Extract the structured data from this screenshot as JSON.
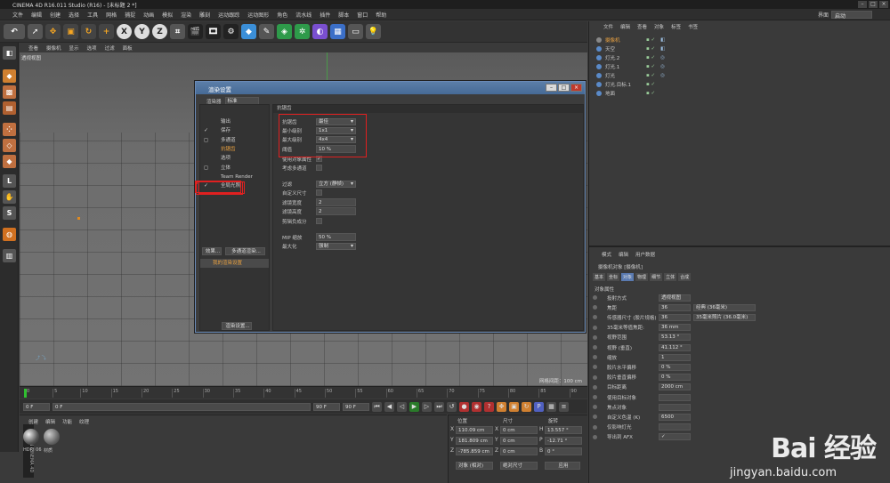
{
  "app": {
    "title": "CINEMA 4D R16.011 Studio (R16) - [未标题 2 *]"
  },
  "menubar": [
    "文件",
    "编辑",
    "创建",
    "选择",
    "工具",
    "网格",
    "捕捉",
    "动画",
    "模拟",
    "渲染",
    "雕刻",
    "运动跟踪",
    "运动图形",
    "角色",
    "流水线",
    "插件",
    "脚本",
    "窗口",
    "帮助"
  ],
  "layout": {
    "label": "界面",
    "value": "启动"
  },
  "toolbar_icons": [
    "undo-icon",
    "select-icon",
    "move-icon",
    "scale-icon",
    "rotate-icon",
    "add-icon",
    "x-axis-icon",
    "y-axis-icon",
    "z-axis-icon",
    "coord-icon",
    "render-view-icon",
    "render-picture-icon",
    "render-settings-icon",
    "cube-icon",
    "pen-icon",
    "subdivision-icon",
    "array-icon",
    "deformer-icon",
    "floor-icon",
    "camera-icon",
    "light-icon"
  ],
  "toolbar_axis": {
    "x": "X",
    "y": "Y",
    "z": "Z"
  },
  "viewport": {
    "menu": [
      "查看",
      "摄像机",
      "显示",
      "选项",
      "过滤",
      "面板"
    ],
    "label": "透视视图",
    "grid_spacing": "网格间距：100 cm"
  },
  "timeline": {
    "ticks": [
      "0",
      "5",
      "10",
      "15",
      "20",
      "25",
      "30",
      "35",
      "40",
      "45",
      "50",
      "55",
      "60",
      "65",
      "70",
      "75",
      "80",
      "85",
      "90"
    ],
    "frame_start": "0 F",
    "frame_current": "0 F",
    "frame_end": "90 F",
    "frame_end2": "90 F"
  },
  "material": {
    "menu": [
      "创建",
      "编辑",
      "功能",
      "纹理"
    ],
    "items": [
      "HDRI 06",
      "材质"
    ]
  },
  "coords": {
    "headers": [
      "位置",
      "尺寸",
      "旋转"
    ],
    "rows": [
      {
        "axis": "X",
        "pos": "110.09 cm",
        "size": "0 cm",
        "rot_axis": "H",
        "rot": "13.557 °"
      },
      {
        "axis": "Y",
        "pos": "181.809 cm",
        "size": "0 cm",
        "rot_axis": "P",
        "rot": "-12.71 °"
      },
      {
        "axis": "Z",
        "pos": "-785.859 cm",
        "size": "0 cm",
        "rot_axis": "B",
        "rot": "0 °"
      }
    ],
    "mode1": "对象 (相对)",
    "mode2": "绝对尺寸",
    "apply": "应用"
  },
  "objects": {
    "menu": [
      "文件",
      "编辑",
      "查看",
      "对象",
      "标签",
      "书签"
    ],
    "items": [
      {
        "name": "摄像机",
        "color": "#e8a040"
      },
      {
        "name": "天空",
        "color": "#c8c8c8"
      },
      {
        "name": "灯光.2",
        "color": "#c8c8c8"
      },
      {
        "name": "灯光.1",
        "color": "#c8c8c8"
      },
      {
        "name": "灯光",
        "color": "#c8c8c8"
      },
      {
        "name": "灯光.目标.1",
        "color": "#c8c8c8"
      },
      {
        "name": "地面",
        "color": "#c8c8c8"
      }
    ]
  },
  "attributes": {
    "menu": [
      "模式",
      "编辑",
      "用户数据"
    ],
    "object_title": "摄像机对象 [摄像机]",
    "tabs": [
      "基本",
      "坐标",
      "对象",
      "物理",
      "细节",
      "立体",
      "合成"
    ],
    "active_tab": "对象",
    "section": "对象属性",
    "rows": [
      {
        "label": "投射方式",
        "value": "透视视图"
      },
      {
        "label": "焦距",
        "value": "36",
        "extra": "经典 (36毫米)"
      },
      {
        "label": "传感器尺寸 (胶片规格)",
        "value": "36",
        "extra": "35毫米照片 (36.0毫米)"
      },
      {
        "label": "35毫米等值焦距:",
        "value": "36 mm"
      },
      {
        "label": "视野范围",
        "value": "53.13 °"
      },
      {
        "label": "视野 (垂直)",
        "value": "41.112 °"
      },
      {
        "label": "缩放",
        "value": "1"
      },
      {
        "label": "胶片水平偏移",
        "value": "0 %"
      },
      {
        "label": "胶片垂直偏移",
        "value": "0 %"
      },
      {
        "label": "目标距离",
        "value": "2000 cm"
      },
      {
        "label": "使用目标对象",
        "value": ""
      },
      {
        "label": "焦点对象",
        "value": ""
      },
      {
        "label": "自定义色温 (K)",
        "value": "6500"
      },
      {
        "label": "仅影响灯光",
        "value": ""
      },
      {
        "label": "导出到 AFX",
        "value": "✓"
      }
    ]
  },
  "dialog": {
    "title": "渲染设置",
    "renderer_label": "渲染器",
    "renderer_value": "标准",
    "left_items": [
      {
        "label": "输出",
        "check": ""
      },
      {
        "label": "保存",
        "check": "✓"
      },
      {
        "label": "多通道",
        "check": "◻"
      },
      {
        "label": "抗锯齿",
        "check": "",
        "highlight": true
      },
      {
        "label": "选项",
        "check": ""
      },
      {
        "label": "立体",
        "check": "◻"
      },
      {
        "label": "Team Render",
        "check": ""
      },
      {
        "label": "全局光照",
        "check": "✓"
      }
    ],
    "effect_btn": "效果...",
    "multi_btn": "多通道渲染...",
    "my_setting": "我的渲染设置",
    "render_setting_btn": "渲染设置...",
    "section_title": "抗锯齿",
    "right_rows": [
      {
        "label": "抗锯齿",
        "value": "最佳",
        "type": "select"
      },
      {
        "label": "最小级别",
        "value": "1x1",
        "type": "select"
      },
      {
        "label": "最大级别",
        "value": "4x4",
        "type": "select"
      },
      {
        "label": "阈值",
        "value": "10 %",
        "type": "field"
      },
      {
        "label": "使用对象属性",
        "value": "✓",
        "type": "check"
      },
      {
        "label": "考虑多通道",
        "value": "",
        "type": "check"
      },
      {
        "label": "过滤",
        "value": "立方 (静帧)",
        "type": "select"
      },
      {
        "label": "自定义尺寸",
        "value": "",
        "type": "check"
      },
      {
        "label": "滤镜宽度",
        "value": "2",
        "type": "field"
      },
      {
        "label": "滤镜高度",
        "value": "2",
        "type": "field"
      },
      {
        "label": "剪辑负成分",
        "value": "",
        "type": "check"
      },
      {
        "label": "MIP 缩放",
        "value": "50 %",
        "type": "field"
      },
      {
        "label": "最大化",
        "value": "强制",
        "type": "select"
      }
    ]
  },
  "watermark": {
    "brand": "Bai 经验",
    "url": "jingyan.baidu.com"
  }
}
